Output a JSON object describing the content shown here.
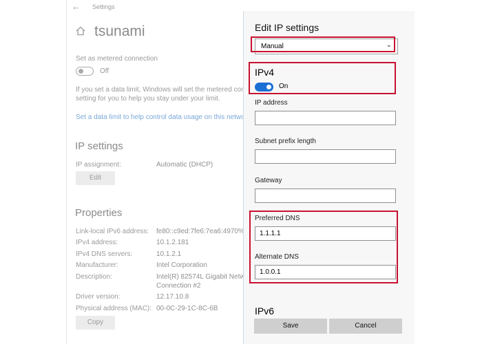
{
  "window": {
    "title": "Settings"
  },
  "background": {
    "network_name": "tsunami",
    "metered": {
      "label": "Set as metered connection",
      "state": "Off"
    },
    "data_limit_text_1": "If you set a data limit, Windows will set the metered conn",
    "data_limit_text_2": "setting for you to help you stay under your limit.",
    "data_limit_link": "Set a data limit to help control data usage on this netwo",
    "ip_settings": {
      "heading": "IP settings",
      "assignment_label": "IP assignment:",
      "assignment_value": "Automatic (DHCP)",
      "edit_button": "Edit"
    },
    "properties": {
      "heading": "Properties",
      "rows": [
        {
          "label": "Link-local IPv6 address:",
          "value": "fe80::c9ed:7fe6:7ea6:4970%6"
        },
        {
          "label": "IPv4 address:",
          "value": "10.1.2.181"
        },
        {
          "label": "IPv4 DNS servers:",
          "value": "10.1.2.1"
        },
        {
          "label": "Manufacturer:",
          "value": "Intel Corporation"
        },
        {
          "label": "Description:",
          "value": "Intel(R) 82574L Gigabit Netwo"
        },
        {
          "label": "",
          "value": "Connection #2"
        },
        {
          "label": "Driver version:",
          "value": "12.17.10.8"
        },
        {
          "label": "Physical address (MAC):",
          "value": "00-0C-29-1C-8C-6B"
        }
      ],
      "copy_button": "Copy"
    }
  },
  "dialog": {
    "title": "Edit IP settings",
    "mode_select": {
      "value": "Manual"
    },
    "ipv4": {
      "heading": "IPv4",
      "toggle_state": "On"
    },
    "fields": {
      "ip_address": {
        "label": "IP address",
        "value": ""
      },
      "subnet": {
        "label": "Subnet prefix length",
        "value": ""
      },
      "gateway": {
        "label": "Gateway",
        "value": ""
      },
      "preferred_dns": {
        "label": "Preferred DNS",
        "value": "1.1.1.1"
      },
      "alternate_dns": {
        "label": "Alternate DNS",
        "value": "1.0.0.1"
      }
    },
    "ipv6": {
      "heading": "IPv6"
    },
    "save_button": "Save",
    "cancel_button": "Cancel"
  },
  "colors": {
    "highlight": "#c8102e",
    "toggle_on": "#1a6fd4",
    "link": "#7aa7d8"
  }
}
